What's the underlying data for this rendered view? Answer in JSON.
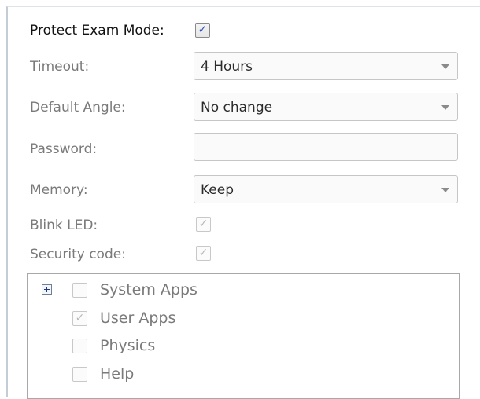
{
  "form": {
    "protect_exam_mode": {
      "label": "Protect Exam Mode:",
      "checked": true
    },
    "timeout": {
      "label": "Timeout:",
      "value": "4 Hours"
    },
    "default_angle": {
      "label": "Default Angle:",
      "value": "No change"
    },
    "password": {
      "label": "Password:",
      "value": ""
    },
    "memory": {
      "label": "Memory:",
      "value": "Keep"
    },
    "blink_led": {
      "label": "Blink LED:",
      "checked": true
    },
    "security_code": {
      "label": "Security code:",
      "checked": true
    }
  },
  "apps_tree": {
    "items": [
      {
        "label": "System Apps",
        "checked": false,
        "expandable": true
      },
      {
        "label": "User Apps",
        "checked": true
      },
      {
        "label": "Physics",
        "checked": false
      },
      {
        "label": "Help",
        "checked": false
      }
    ]
  },
  "glyphs": {
    "check": "✓"
  },
  "colors": {
    "check_active": "#2e55b8",
    "text_disabled": "#7a7a7a"
  }
}
